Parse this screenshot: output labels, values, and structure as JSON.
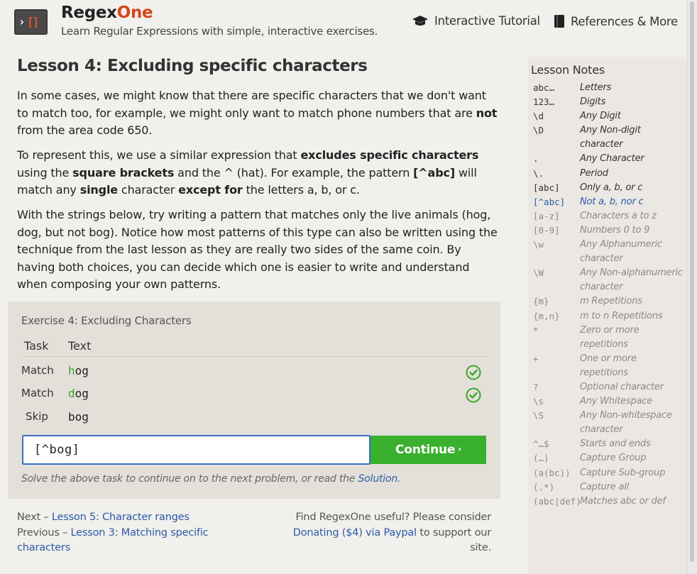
{
  "header": {
    "logo_chevron": "›",
    "logo_brackets": "[]",
    "brand_regex": "Regex",
    "brand_one": "One",
    "tagline": "Learn Regular Expressions with simple, interactive exercises.",
    "nav_tutorial": "Interactive Tutorial",
    "nav_references": "References & More"
  },
  "lesson": {
    "title": "Lesson 4: Excluding specific characters",
    "p1": {
      "a": "In some cases, we might know that there are specific characters that we don't want to match too, for example, we might only want to match phone numbers that are ",
      "b": "not",
      "c": " from the area code 650."
    },
    "p2": {
      "a": "To represent this, we use a similar expression that ",
      "b": "excludes specific characters",
      "c": " using the ",
      "d": "square brackets",
      "e": " and the ^ (hat). For example, the pattern ",
      "f": "[^abc]",
      "g": " will match any ",
      "h": "single",
      "i": " character ",
      "j": "except for",
      "k": " the letters a, b, or c."
    },
    "p3": "With the strings below, try writing a pattern that matches only the live animals (hog, dog, but not bog). Notice how most patterns of this type can also be written using the technique from the last lesson as they are really two sides of the same coin. By having both choices, you can decide which one is easier to write and understand when composing your own patterns."
  },
  "exercise": {
    "title": "Exercise 4: Excluding Characters",
    "col_task": "Task",
    "col_text": "Text",
    "rows": [
      {
        "task": "Match",
        "hl": "h",
        "rest": "og",
        "status": "check-circle-icon"
      },
      {
        "task": "Match",
        "hl": "d",
        "rest": "og",
        "status": "check-circle-icon"
      },
      {
        "task": "Skip",
        "hl": "",
        "rest": "bog",
        "status": ""
      }
    ],
    "input_value": "[^bog]",
    "continue_label": "Continue",
    "continue_arrow": "›",
    "hint_prefix": "Solve the above task to continue on to the next problem, or read the ",
    "hint_link": "Solution",
    "hint_suffix": "."
  },
  "footer": {
    "next_label": "Next – ",
    "next_link": "Lesson 5: Character ranges",
    "prev_label": "Previous – ",
    "prev_link": "Lesson 3: Matching specific characters",
    "donate_prefix": "Find RegexOne useful? Please consider ",
    "donate_link": "Donating ($4) via Paypal",
    "donate_suffix": " to support our site."
  },
  "notes": {
    "title": "Lesson Notes",
    "items": [
      {
        "key": "abc…",
        "desc": "Letters",
        "state": "normal"
      },
      {
        "key": "123…",
        "desc": "Digits",
        "state": "normal"
      },
      {
        "key": "\\d",
        "desc": "Any Digit",
        "state": "normal"
      },
      {
        "key": "\\D",
        "desc": "Any Non-digit character",
        "state": "normal"
      },
      {
        "key": ".",
        "desc": "Any Character",
        "state": "normal"
      },
      {
        "key": "\\.",
        "desc": "Period",
        "state": "normal"
      },
      {
        "key": "[abc]",
        "desc": "Only a, b, or c",
        "state": "normal"
      },
      {
        "key": "[^abc]",
        "desc": "Not a, b, nor c",
        "state": "active"
      },
      {
        "key": "[a-z]",
        "desc": "Characters a to z",
        "state": "dim"
      },
      {
        "key": "[0-9]",
        "desc": "Numbers 0 to 9",
        "state": "dim"
      },
      {
        "key": "\\w",
        "desc": "Any Alphanumeric character",
        "state": "dim"
      },
      {
        "key": "\\W",
        "desc": "Any Non-alphanumeric character",
        "state": "dim"
      },
      {
        "key": "{m}",
        "desc": "m Repetitions",
        "state": "dim"
      },
      {
        "key": "{m,n}",
        "desc": "m to n Repetitions",
        "state": "dim"
      },
      {
        "key": "*",
        "desc": "Zero or more repetitions",
        "state": "dim"
      },
      {
        "key": "+",
        "desc": "One or more repetitions",
        "state": "dim"
      },
      {
        "key": "?",
        "desc": "Optional character",
        "state": "dim"
      },
      {
        "key": "\\s",
        "desc": "Any Whitespace",
        "state": "dim"
      },
      {
        "key": "\\S",
        "desc": "Any Non-whitespace character",
        "state": "dim"
      },
      {
        "key": "^…$",
        "desc": "Starts and ends",
        "state": "dim"
      },
      {
        "key": "(…)",
        "desc": "Capture Group",
        "state": "dim"
      },
      {
        "key": "(a(bc))",
        "desc": "Capture Sub-group",
        "state": "dim"
      },
      {
        "key": "(.*)",
        "desc": "Capture all",
        "state": "dim"
      },
      {
        "key": "(abc|def)",
        "desc": "Matches abc or def",
        "state": "dim"
      }
    ]
  },
  "colors": {
    "accent_orange": "#d8441c",
    "link_blue": "#2a5aa8",
    "success_green": "#3ab02f"
  }
}
